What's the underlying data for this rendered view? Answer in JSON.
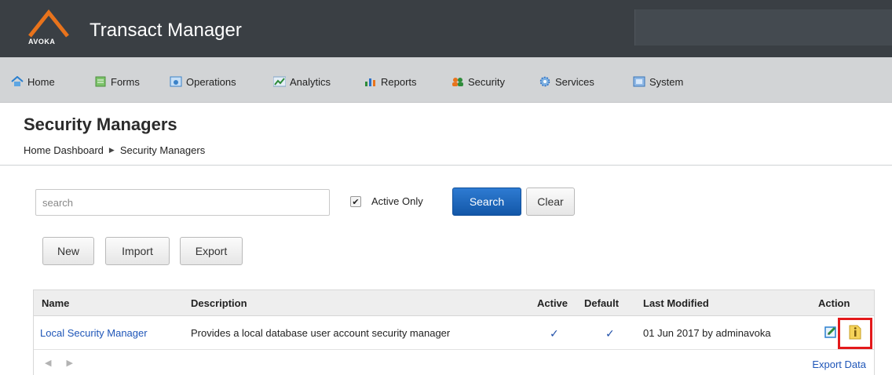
{
  "header": {
    "logo_text": "AVOKA",
    "app_title": "Transact Manager"
  },
  "nav": {
    "items": [
      {
        "label": "Home",
        "icon": "home-icon"
      },
      {
        "label": "Forms",
        "icon": "forms-icon"
      },
      {
        "label": "Operations",
        "icon": "operations-icon"
      },
      {
        "label": "Analytics",
        "icon": "analytics-icon"
      },
      {
        "label": "Reports",
        "icon": "reports-icon"
      },
      {
        "label": "Security",
        "icon": "security-icon"
      },
      {
        "label": "Services",
        "icon": "services-icon"
      },
      {
        "label": "System",
        "icon": "system-icon"
      }
    ]
  },
  "page": {
    "title": "Security Managers",
    "breadcrumb": [
      "Home Dashboard",
      "Security Managers"
    ]
  },
  "filters": {
    "search_placeholder": "search",
    "search_value": "",
    "active_only_label": "Active Only",
    "active_only_checked": true,
    "search_button": "Search",
    "clear_button": "Clear"
  },
  "toolbar": {
    "new_label": "New",
    "import_label": "Import",
    "export_label": "Export"
  },
  "table": {
    "columns": [
      "Name",
      "Description",
      "Active",
      "Default",
      "Last Modified",
      "Action"
    ],
    "rows": [
      {
        "name": "Local Security Manager",
        "description": "Provides a local database user account security manager",
        "active": "✓",
        "default": "✓",
        "last_modified": "01 Jun 2017 by adminavoka"
      }
    ],
    "pager": "◀ ▶",
    "export_data": "Export Data"
  },
  "colors": {
    "topbar": "#3a3f44",
    "navbar": "#d2d4d6",
    "primary_button": "#1e68c1",
    "link": "#1f56b8",
    "highlight": "#e3191b"
  }
}
